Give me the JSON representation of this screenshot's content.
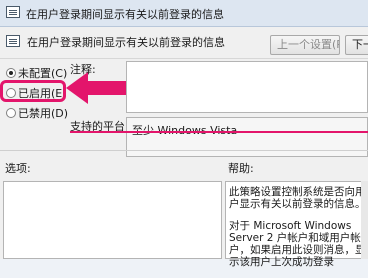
{
  "window": {
    "title": "在用户登录期间显示有关以前登录的信息"
  },
  "header": {
    "title": "在用户登录期间显示有关以前登录的信息",
    "prev_button": "上一个设置(P)",
    "next_button": "下一"
  },
  "options": {
    "not_configured": "未配置(C)",
    "enabled": "已启用(E)",
    "disabled": "已禁用(D)",
    "selected": "not_configured"
  },
  "comment": {
    "label": "注释:"
  },
  "supported": {
    "label": "支持的平台:",
    "value": "至少 Windows Vista"
  },
  "sections": {
    "options_label": "选项:",
    "help_label": "帮助:"
  },
  "help": {
    "paragraph1": "此策略设置控制系统是否向用户显示有关以前登录的信息。",
    "paragraph2": "对于 Microsoft Windows Server 2 户帐户和域用户帐户，如果启用此设则消息，显示该用户上次成功登录"
  },
  "colors": {
    "highlight": "#e3156b"
  }
}
